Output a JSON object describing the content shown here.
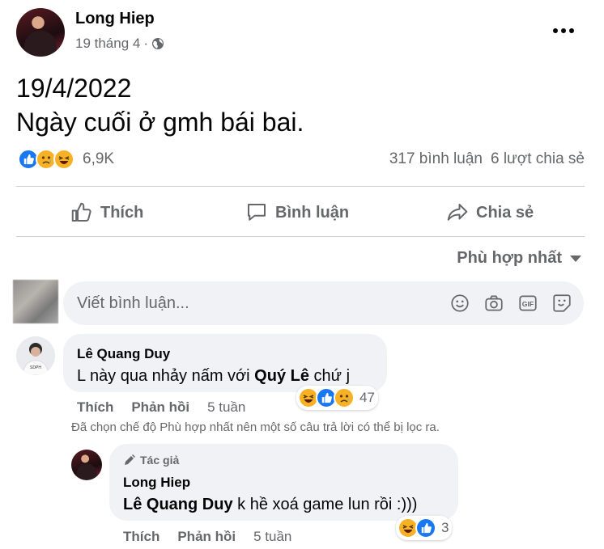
{
  "post": {
    "author": "Long Hiep",
    "date": "19 tháng 4",
    "separator": "·",
    "text_line1": "19/4/2022",
    "text_line2": "Ngày cuối ở gmh bái bai.",
    "reaction_count": "6,9K",
    "comment_count": "317 bình luận",
    "share_count": "6 lượt chia sẻ"
  },
  "actions": {
    "like": "Thích",
    "comment": "Bình luận",
    "share": "Chia sẻ"
  },
  "sort": {
    "label": "Phù hợp nhất"
  },
  "composer": {
    "placeholder": "Viết bình luận..."
  },
  "comments": [
    {
      "author": "Lê Quang Duy",
      "text_prefix": "L này qua nhảy nấm với ",
      "mention": "Quý Lê",
      "text_suffix": " chứ j",
      "like": "Thích",
      "reply": "Phản hồi",
      "time": "5 tuần",
      "reaction_count": "47"
    }
  ],
  "filter_note": "Đã chọn chế độ Phù hợp nhất nên một số câu trả lời có thể bị lọc ra.",
  "reply": {
    "badge": "Tác giả",
    "author": "Long Hiep",
    "mention": "Lê Quang Duy",
    "text": " k hề xoá game lun rồi :)))",
    "like": "Thích",
    "reply": "Phản hồi",
    "time": "5 tuần",
    "reaction_count": "3"
  },
  "colors": {
    "secondary_text": "#65676b",
    "like_blue": "#1877f2",
    "bubble_bg": "#f0f2f5",
    "emoji_yellow": "#f7b125"
  }
}
